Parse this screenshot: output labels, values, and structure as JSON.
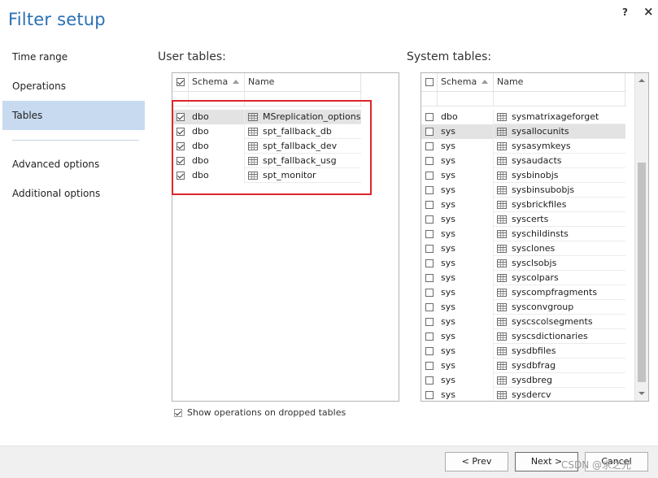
{
  "window": {
    "title": "Filter setup",
    "help_label": "?",
    "close_label": "×"
  },
  "nav": {
    "items": [
      {
        "label": "Time range",
        "selected": false
      },
      {
        "label": "Operations",
        "selected": false
      },
      {
        "label": "Tables",
        "selected": true
      },
      {
        "label": "Advanced options",
        "selected": false
      },
      {
        "label": "Additional options",
        "selected": false
      }
    ]
  },
  "user_tables": {
    "label": "User tables:",
    "columns": {
      "schema": "Schema",
      "name": "Name"
    },
    "header_checked": true,
    "rows": [
      {
        "checked": true,
        "schema": "dbo",
        "name": "MSreplication_options",
        "highlight": true
      },
      {
        "checked": true,
        "schema": "dbo",
        "name": "spt_fallback_db",
        "highlight": false
      },
      {
        "checked": true,
        "schema": "dbo",
        "name": "spt_fallback_dev",
        "highlight": false
      },
      {
        "checked": true,
        "schema": "dbo",
        "name": "spt_fallback_usg",
        "highlight": false
      },
      {
        "checked": true,
        "schema": "dbo",
        "name": "spt_monitor",
        "highlight": false
      }
    ]
  },
  "system_tables": {
    "label": "System tables:",
    "columns": {
      "schema": "Schema",
      "name": "Name"
    },
    "header_checked": false,
    "rows": [
      {
        "checked": false,
        "schema": "dbo",
        "name": "sysmatrixageforget",
        "highlight": false
      },
      {
        "checked": false,
        "schema": "sys",
        "name": "sysallocunits",
        "highlight": true
      },
      {
        "checked": false,
        "schema": "sys",
        "name": "sysasymkeys",
        "highlight": false
      },
      {
        "checked": false,
        "schema": "sys",
        "name": "sysaudacts",
        "highlight": false
      },
      {
        "checked": false,
        "schema": "sys",
        "name": "sysbinobjs",
        "highlight": false
      },
      {
        "checked": false,
        "schema": "sys",
        "name": "sysbinsubobjs",
        "highlight": false
      },
      {
        "checked": false,
        "schema": "sys",
        "name": "sysbrickfiles",
        "highlight": false
      },
      {
        "checked": false,
        "schema": "sys",
        "name": "syscerts",
        "highlight": false
      },
      {
        "checked": false,
        "schema": "sys",
        "name": "syschildinsts",
        "highlight": false
      },
      {
        "checked": false,
        "schema": "sys",
        "name": "sysclones",
        "highlight": false
      },
      {
        "checked": false,
        "schema": "sys",
        "name": "sysclsobjs",
        "highlight": false
      },
      {
        "checked": false,
        "schema": "sys",
        "name": "syscolpars",
        "highlight": false
      },
      {
        "checked": false,
        "schema": "sys",
        "name": "syscompfragments",
        "highlight": false
      },
      {
        "checked": false,
        "schema": "sys",
        "name": "sysconvgroup",
        "highlight": false
      },
      {
        "checked": false,
        "schema": "sys",
        "name": "syscscolsegments",
        "highlight": false
      },
      {
        "checked": false,
        "schema": "sys",
        "name": "syscsdictionaries",
        "highlight": false
      },
      {
        "checked": false,
        "schema": "sys",
        "name": "sysdbfiles",
        "highlight": false
      },
      {
        "checked": false,
        "schema": "sys",
        "name": "sysdbfrag",
        "highlight": false
      },
      {
        "checked": false,
        "schema": "sys",
        "name": "sysdbreg",
        "highlight": false
      },
      {
        "checked": false,
        "schema": "sys",
        "name": "sysdercv",
        "highlight": false
      }
    ]
  },
  "show_dropped": {
    "label": "Show operations on dropped tables",
    "checked": true
  },
  "buttons": {
    "prev": "< Prev",
    "next": "Next >",
    "cancel": "Cancel"
  },
  "watermark": "CSDN @求之光",
  "icons": {
    "help": "help-icon",
    "close": "close-icon",
    "table": "table-icon",
    "sort": "sort-ascending-icon"
  },
  "colors": {
    "title": "#2a6fb5",
    "nav_selected": "#c7daf0",
    "annotation": "#d9262c"
  }
}
